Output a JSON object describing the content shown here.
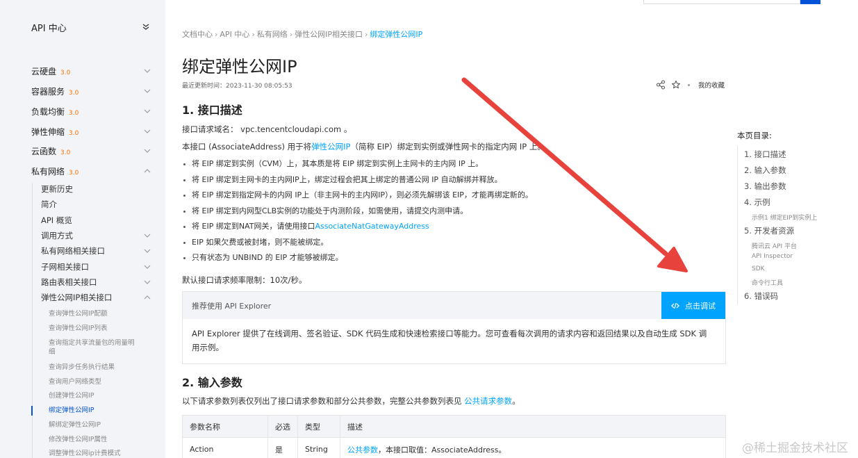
{
  "sidebar": {
    "title": "API 中心",
    "categories": [
      {
        "label": "云硬盘",
        "version": "3.0"
      },
      {
        "label": "容器服务",
        "version": "3.0"
      },
      {
        "label": "负载均衡",
        "version": "3.0"
      },
      {
        "label": "弹性伸缩",
        "version": "3.0"
      },
      {
        "label": "云函数",
        "version": "3.0"
      },
      {
        "label": "私有网络",
        "version": "3.0"
      }
    ],
    "sub_items": [
      {
        "label": "更新历史"
      },
      {
        "label": "简介"
      },
      {
        "label": "API 概览"
      },
      {
        "label": "调用方式"
      },
      {
        "label": "私有网络相关接口"
      },
      {
        "label": "子网相关接口"
      },
      {
        "label": "路由表相关接口"
      },
      {
        "label": "弹性公网IP相关接口"
      }
    ],
    "leaf_items": [
      {
        "label": "查询弹性公网IP配额"
      },
      {
        "label": "查询弹性公网IP列表"
      },
      {
        "label": "查询指定共享流量包的用量明细"
      },
      {
        "label": "查询异步任务执行结果"
      },
      {
        "label": "查询用户网络类型"
      },
      {
        "label": "创建弹性公网IP"
      },
      {
        "label": "绑定弹性公网IP"
      },
      {
        "label": "解绑定弹性公网IP"
      },
      {
        "label": "修改弹性公网IP属性"
      },
      {
        "label": "调整弹性公网ip计费模式"
      }
    ]
  },
  "breadcrumb": {
    "items": [
      "文档中心",
      "API 中心",
      "私有网络",
      "弹性公网IP相关接口"
    ],
    "current": "绑定弹性公网IP",
    "separator": "›"
  },
  "page": {
    "title": "绑定弹性公网IP",
    "updated": "最近更新时间：2023-11-30 08:05:53",
    "favorite": "我的收藏"
  },
  "section1": {
    "heading": "1. 接口描述",
    "domain_label": "接口请求域名：",
    "domain_value": "vpc.tencentcloudapi.com 。",
    "intro_before": "本接口 (AssociateAddress) 用于将",
    "intro_link": "弹性公网IP",
    "intro_after": "（简称 EIP）绑定到实例或弹性网卡的指定内网 IP 上。",
    "bullets": [
      {
        "text": "将 EIP 绑定到实例（CVM）上，其本质是将 EIP 绑定到实例上主网卡的主内网 IP 上。",
        "link": ""
      },
      {
        "text": "将 EIP 绑定到主网卡的主内网IP上，绑定过程会把其上绑定的普通公网 IP 自动解绑并释放。",
        "link": ""
      },
      {
        "text": "将 EIP 绑定到指定网卡的内网 IP上（非主网卡的主内网IP），则必须先解绑该 EIP，才能再绑定新的。",
        "link": ""
      },
      {
        "text": "将 EIP 绑定到内网型CLB实例的功能处于内测阶段，如需使用，请提交内测申请。",
        "link": ""
      },
      {
        "text": "将 EIP 绑定到NAT网关，请使用接口",
        "link": "AssociateNatGatewayAddress"
      },
      {
        "text": "EIP 如果欠费或被封堵，则不能被绑定。",
        "link": ""
      },
      {
        "text": "只有状态为 UNBIND 的 EIP 才能够被绑定。",
        "link": ""
      }
    ],
    "rate_limit": "默认接口请求频率限制：10次/秒。"
  },
  "explorer": {
    "title": "推荐使用 API Explorer",
    "button": "点击调试",
    "body": "API Explorer 提供了在线调用、签名验证、SDK 代码生成和快速检索接口等能力。您可查看每次调用的请求内容和返回结果以及自动生成 SDK 调用示例。"
  },
  "section2": {
    "heading": "2. 输入参数",
    "intro_before": "以下请求参数列表仅列出了接口请求参数和部分公共参数，完整公共参数列表见 ",
    "intro_link": "公共请求参数",
    "intro_after": "。",
    "table": {
      "headers": [
        "参数名称",
        "必选",
        "类型",
        "描述"
      ],
      "rows": [
        {
          "name": "Action",
          "required": "是",
          "type": "String",
          "desc_link": "公共参数",
          "desc": "，本接口取值：AssociateAddress。"
        }
      ]
    }
  },
  "toc": {
    "title": "本页目录:",
    "items": [
      {
        "label": "1. 接口描述"
      },
      {
        "label": "2. 输入参数"
      },
      {
        "label": "3. 输出参数"
      },
      {
        "label": "4. 示例"
      },
      {
        "label": "示例1 绑定EIP到实例上"
      },
      {
        "label": "5. 开发者资源"
      },
      {
        "label": "腾讯云 API 平台"
      },
      {
        "label": "API Inspector"
      },
      {
        "label": "SDK"
      },
      {
        "label": "命令行工具"
      },
      {
        "label": "6. 错误码"
      }
    ]
  },
  "watermark": "@稀土掘金技术社区",
  "colors": {
    "link": "#00a4ff",
    "accent": "#0052d9",
    "version": "#ff7200",
    "arrow": "#e8423c"
  }
}
